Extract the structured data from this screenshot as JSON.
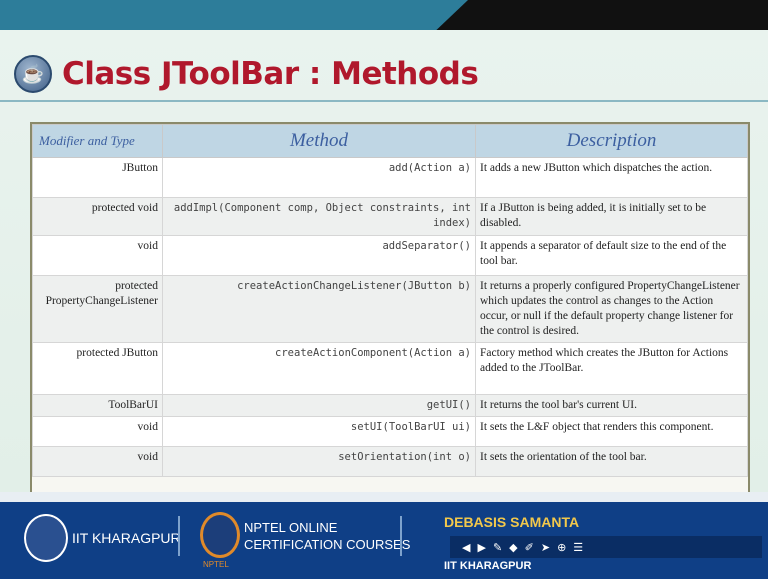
{
  "slide": {
    "title": "Class JToolBar : Methods",
    "logo_icon": "java-logo-icon"
  },
  "table": {
    "headers": [
      "Modifier and Type",
      "Method",
      "Description"
    ],
    "rows": [
      {
        "modifier": "JButton",
        "method": "add(Action a)",
        "description": "It adds a new JButton which dispatches the action."
      },
      {
        "modifier": "protected void",
        "method": "addImpl(Component comp, Object constraints, int index)",
        "description": "If a JButton is being added, it is initially set to be disabled."
      },
      {
        "modifier": "void",
        "method": "addSeparator()",
        "description": "It appends a separator of default size to the end of the tool bar."
      },
      {
        "modifier": "protected PropertyChangeListener",
        "method": "createActionChangeListener(JButton b)",
        "description": "It returns a properly configured PropertyChangeListener which updates the control as changes to the Action occur, or null if the default property change listener for the control is desired."
      },
      {
        "modifier": "protected JButton",
        "method": "createActionComponent(Action a)",
        "description": "Factory method which creates the JButton for Actions added to the JToolBar."
      },
      {
        "modifier": "ToolBarUI",
        "method": "getUI()",
        "description": "It returns the tool bar's current UI."
      },
      {
        "modifier": "void",
        "method": "setUI(ToolBarUI ui)",
        "description": "It sets the L&F object that renders this component."
      },
      {
        "modifier": "void",
        "method": "setOrientation(int o)",
        "description": "It sets the orientation of the tool bar."
      }
    ]
  },
  "footer": {
    "institute": "IIT KHARAGPUR",
    "nptel_line1": "NPTEL ONLINE",
    "nptel_line2": "CERTIFICATION COURSES",
    "nptel_small": "NPTEL",
    "presenter": "DEBASIS SAMANTA",
    "presenter_institute": "IIT KHARAGPUR",
    "toolbar_icons": [
      "prev-icon",
      "next-icon",
      "pen-icon",
      "eraser-icon",
      "highlight-icon",
      "pointer-icon",
      "zoom-icon",
      "menu-icon"
    ]
  }
}
